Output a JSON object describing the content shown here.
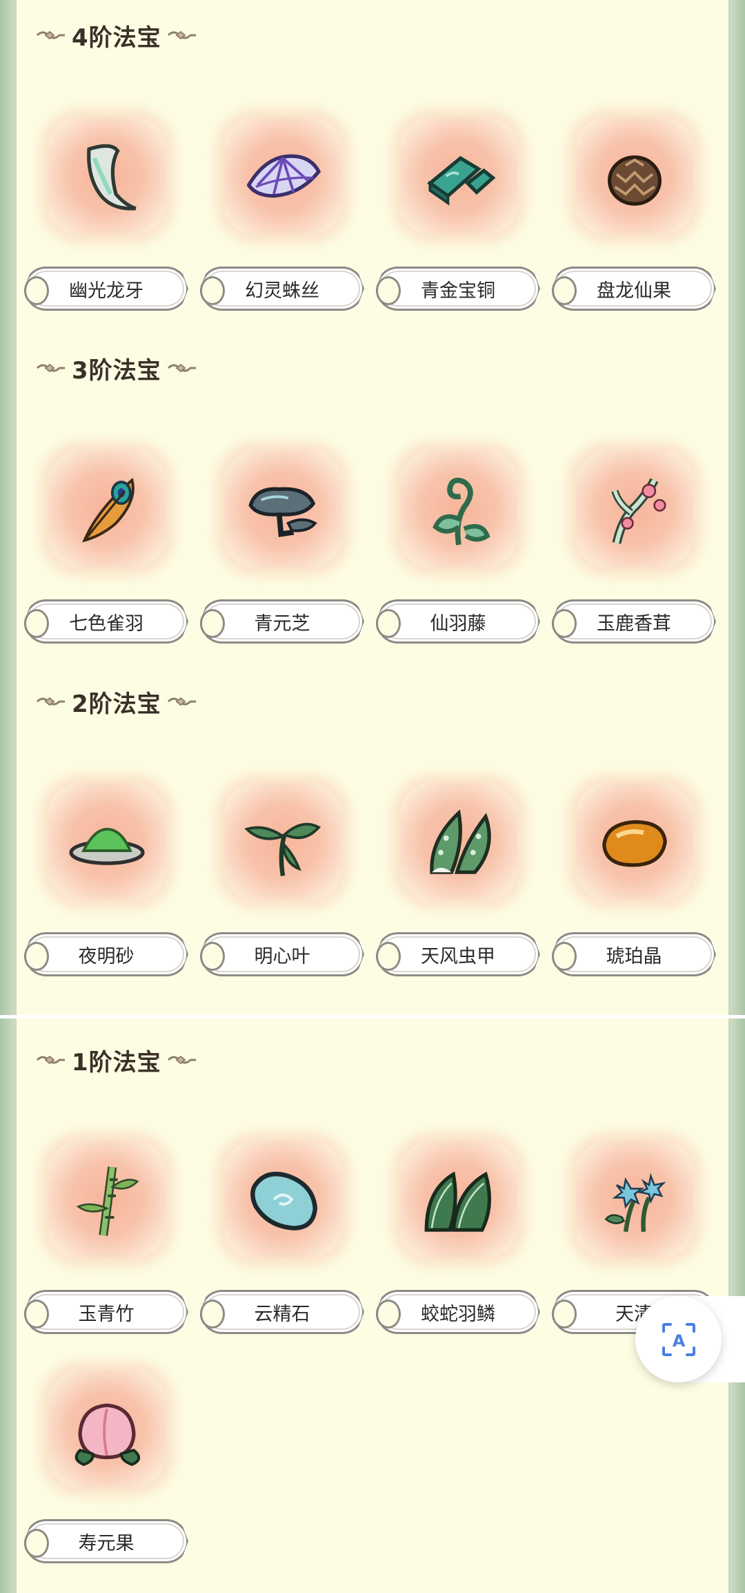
{
  "sections": [
    {
      "title": "4阶法宝",
      "items": [
        {
          "name": "幽光龙牙",
          "icon": "dragon-tooth-icon"
        },
        {
          "name": "幻灵蛛丝",
          "icon": "spider-silk-icon"
        },
        {
          "name": "青金宝铜",
          "icon": "bronze-ingot-icon"
        },
        {
          "name": "盘龙仙果",
          "icon": "pinecone-fruit-icon"
        }
      ]
    },
    {
      "title": "3阶法宝",
      "items": [
        {
          "name": "七色雀羽",
          "icon": "peacock-feather-icon"
        },
        {
          "name": "青元芝",
          "icon": "lingzhi-mushroom-icon"
        },
        {
          "name": "仙羽藤",
          "icon": "vine-icon"
        },
        {
          "name": "玉鹿香茸",
          "icon": "antler-icon"
        }
      ]
    },
    {
      "title": "2阶法宝",
      "items": [
        {
          "name": "夜明砂",
          "icon": "green-sand-icon"
        },
        {
          "name": "明心叶",
          "icon": "leaf-sprig-icon"
        },
        {
          "name": "天风虫甲",
          "icon": "beetle-shell-icon"
        },
        {
          "name": "琥珀晶",
          "icon": "amber-icon"
        }
      ]
    },
    {
      "title": "1阶法宝",
      "items": [
        {
          "name": "玉青竹",
          "icon": "bamboo-icon"
        },
        {
          "name": "云精石",
          "icon": "cloud-stone-icon"
        },
        {
          "name": "蛟蛇羽鳞",
          "icon": "scale-icon"
        },
        {
          "name": "天清",
          "icon": "blue-flower-icon"
        },
        {
          "name": "寿元果",
          "icon": "peach-icon"
        }
      ]
    }
  ],
  "floating_button": {
    "icon": "text-recognition-icon",
    "label": "A"
  },
  "colors": {
    "background": "#fdfde4",
    "tile": "#f7b49b",
    "border": "#a9c4a6",
    "label_border": "#8d8a86"
  }
}
